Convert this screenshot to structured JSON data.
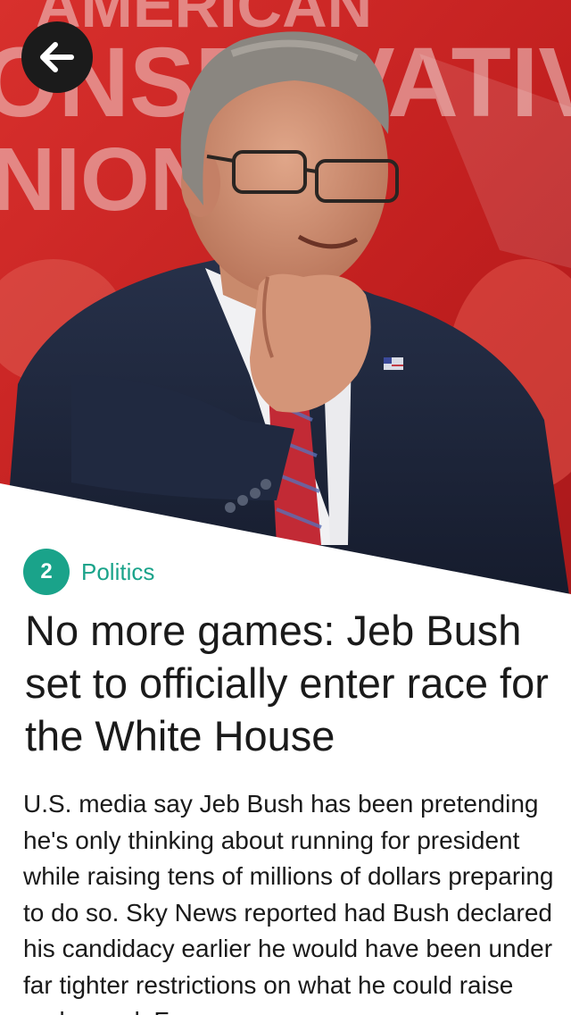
{
  "hero": {
    "background_text": [
      "AMERICAN",
      "ONSERVATIV",
      "NION"
    ],
    "back_icon": "arrow-left-icon"
  },
  "article": {
    "story_number": "2",
    "category": "Politics",
    "headline": "No more games: Jeb Bush set to officially enter race for the White House",
    "body": "U.S. media say Jeb Bush has been pretending he's only thinking about running for president while raising tens of millions of dollars preparing to do so. Sky News reported had Bush declared his candidacy earlier he would have been under far tighter restrictions on what he could raise and spend. For"
  },
  "colors": {
    "accent": "#1aa38a",
    "hero_red": "#c9211f",
    "text": "#1a1a1a"
  }
}
